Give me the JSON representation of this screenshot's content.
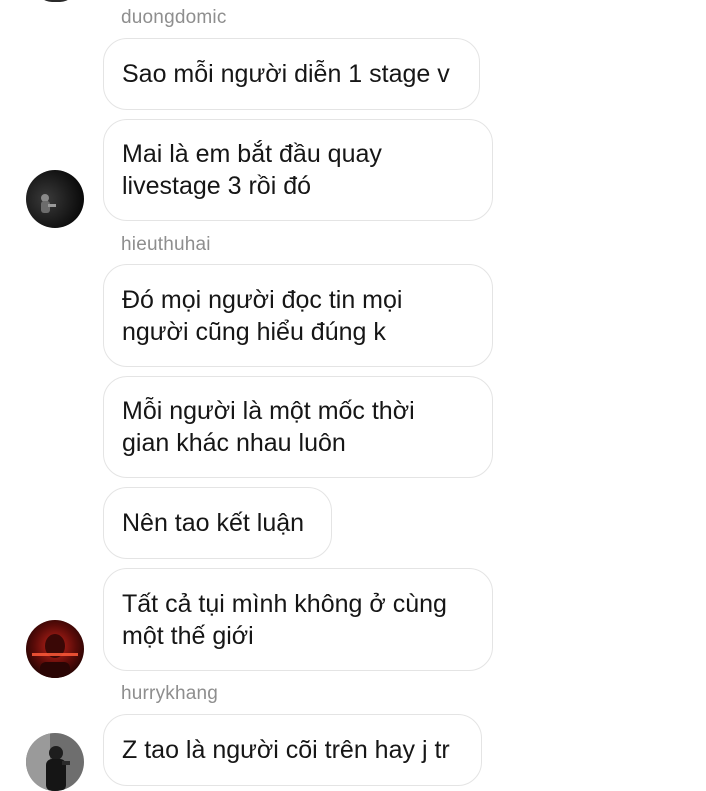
{
  "chat": {
    "groups": [
      {
        "username": "duongdomic",
        "messages": [
          "Sao mỗi người diễn 1 stage v",
          "Mai là em bắt đầu quay livestage 3 rồi đó"
        ]
      },
      {
        "username": "hieuthuhai",
        "messages": [
          "Đó mọi người đọc tin mọi người cũng hiểu đúng k",
          "Mỗi người là một mốc thời gian khác nhau luôn",
          "Nên tao kết luận",
          "Tất cả tụi mình không ở cùng một thế giới"
        ]
      },
      {
        "username": "hurrykhang",
        "messages": [
          "Z tao là người cõi trên hay j tr"
        ]
      }
    ]
  },
  "colors": {
    "bubble_border": "#e4e4e4",
    "username_text": "#8e8e8e",
    "message_text": "#161616"
  }
}
